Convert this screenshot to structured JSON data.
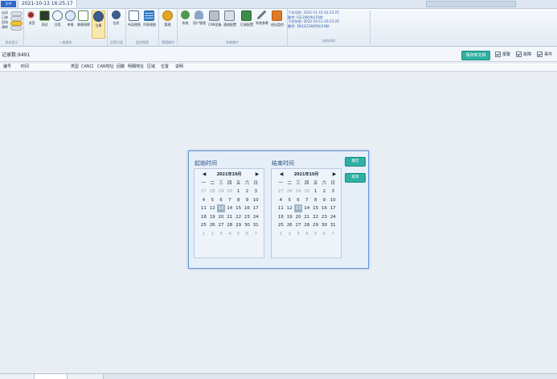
{
  "app": {
    "menu_label": "文件",
    "datetime": "2021-10-13 16:25:17"
  },
  "ribbon": {
    "left_list": {
      "items": [
        "自动",
        "已参",
        "回场",
        "清库"
      ],
      "group_title": "状态显示"
    },
    "groups": [
      {
        "title": "一般操作",
        "buttons": [
          "消音",
          "测试",
          "日程",
          "申报",
          "故障观察",
          "注册"
        ]
      },
      {
        "title": "信息记录",
        "buttons": [
          "信息"
        ]
      },
      {
        "title": "监控视图",
        "buttons": [
          "布局视图",
          "列表视图"
        ]
      },
      {
        "title": "管理操作",
        "buttons": [
          "管理"
        ]
      },
      {
        "title": "系统维护",
        "buttons": [
          "系统",
          "用户管理",
          "CAN设备",
          "通道配置",
          "灯具配置",
          "系统参数",
          "退出监控"
        ]
      }
    ],
    "info": {
      "lines": [
        "下次月检: 2021-11-15 02:23:25",
        "剩余: 0天20时9分19秒",
        "下次年检: 2022-10-13 16:23:25",
        "剩余: 364天23时59分19秒"
      ],
      "group_title": "自检时间"
    }
  },
  "status": {
    "record_count": "记录数:9491",
    "save_button": "保存到文档",
    "checkboxes": [
      "报警",
      "故障",
      "事件"
    ]
  },
  "table": {
    "columns": [
      "编号",
      "时间",
      "类型",
      "CAN口",
      "CAN地址",
      "回路",
      "明细地址",
      "区域",
      "位置",
      "说明"
    ]
  },
  "dialog": {
    "start_title": "起始时间",
    "end_title": "结束时间",
    "confirm_button": "确定",
    "cancel_button": "取消",
    "calendars": [
      {
        "month_label": "2021年10月",
        "prev": "◀",
        "next": "▶",
        "weekdays": [
          "一",
          "二",
          "三",
          "四",
          "五",
          "六",
          "日"
        ],
        "rows": [
          [
            "27",
            "28",
            "29",
            "30",
            "1",
            "2",
            "3"
          ],
          [
            "4",
            "5",
            "6",
            "7",
            "8",
            "9",
            "10"
          ],
          [
            "11",
            "12",
            "13",
            "14",
            "15",
            "16",
            "17"
          ],
          [
            "18",
            "19",
            "20",
            "21",
            "22",
            "23",
            "24"
          ],
          [
            "25",
            "26",
            "27",
            "28",
            "29",
            "30",
            "31"
          ],
          [
            "1",
            "2",
            "3",
            "4",
            "5",
            "6",
            "7"
          ]
        ],
        "today": "13"
      },
      {
        "month_label": "2021年10月",
        "prev": "◀",
        "next": "▶",
        "weekdays": [
          "一",
          "二",
          "三",
          "四",
          "五",
          "六",
          "日"
        ],
        "rows": [
          [
            "27",
            "28",
            "29",
            "30",
            "1",
            "2",
            "3"
          ],
          [
            "4",
            "5",
            "6",
            "7",
            "8",
            "9",
            "10"
          ],
          [
            "11",
            "12",
            "13",
            "14",
            "15",
            "16",
            "17"
          ],
          [
            "18",
            "19",
            "20",
            "21",
            "22",
            "23",
            "24"
          ],
          [
            "25",
            "26",
            "27",
            "28",
            "29",
            "30",
            "31"
          ],
          [
            "1",
            "2",
            "3",
            "4",
            "5",
            "6",
            "7"
          ]
        ],
        "today": "13"
      }
    ]
  },
  "colors": {
    "accent": "#2fb0a4",
    "ribbon_blue": "#2c66c9",
    "info_text": "#2a57b0"
  }
}
